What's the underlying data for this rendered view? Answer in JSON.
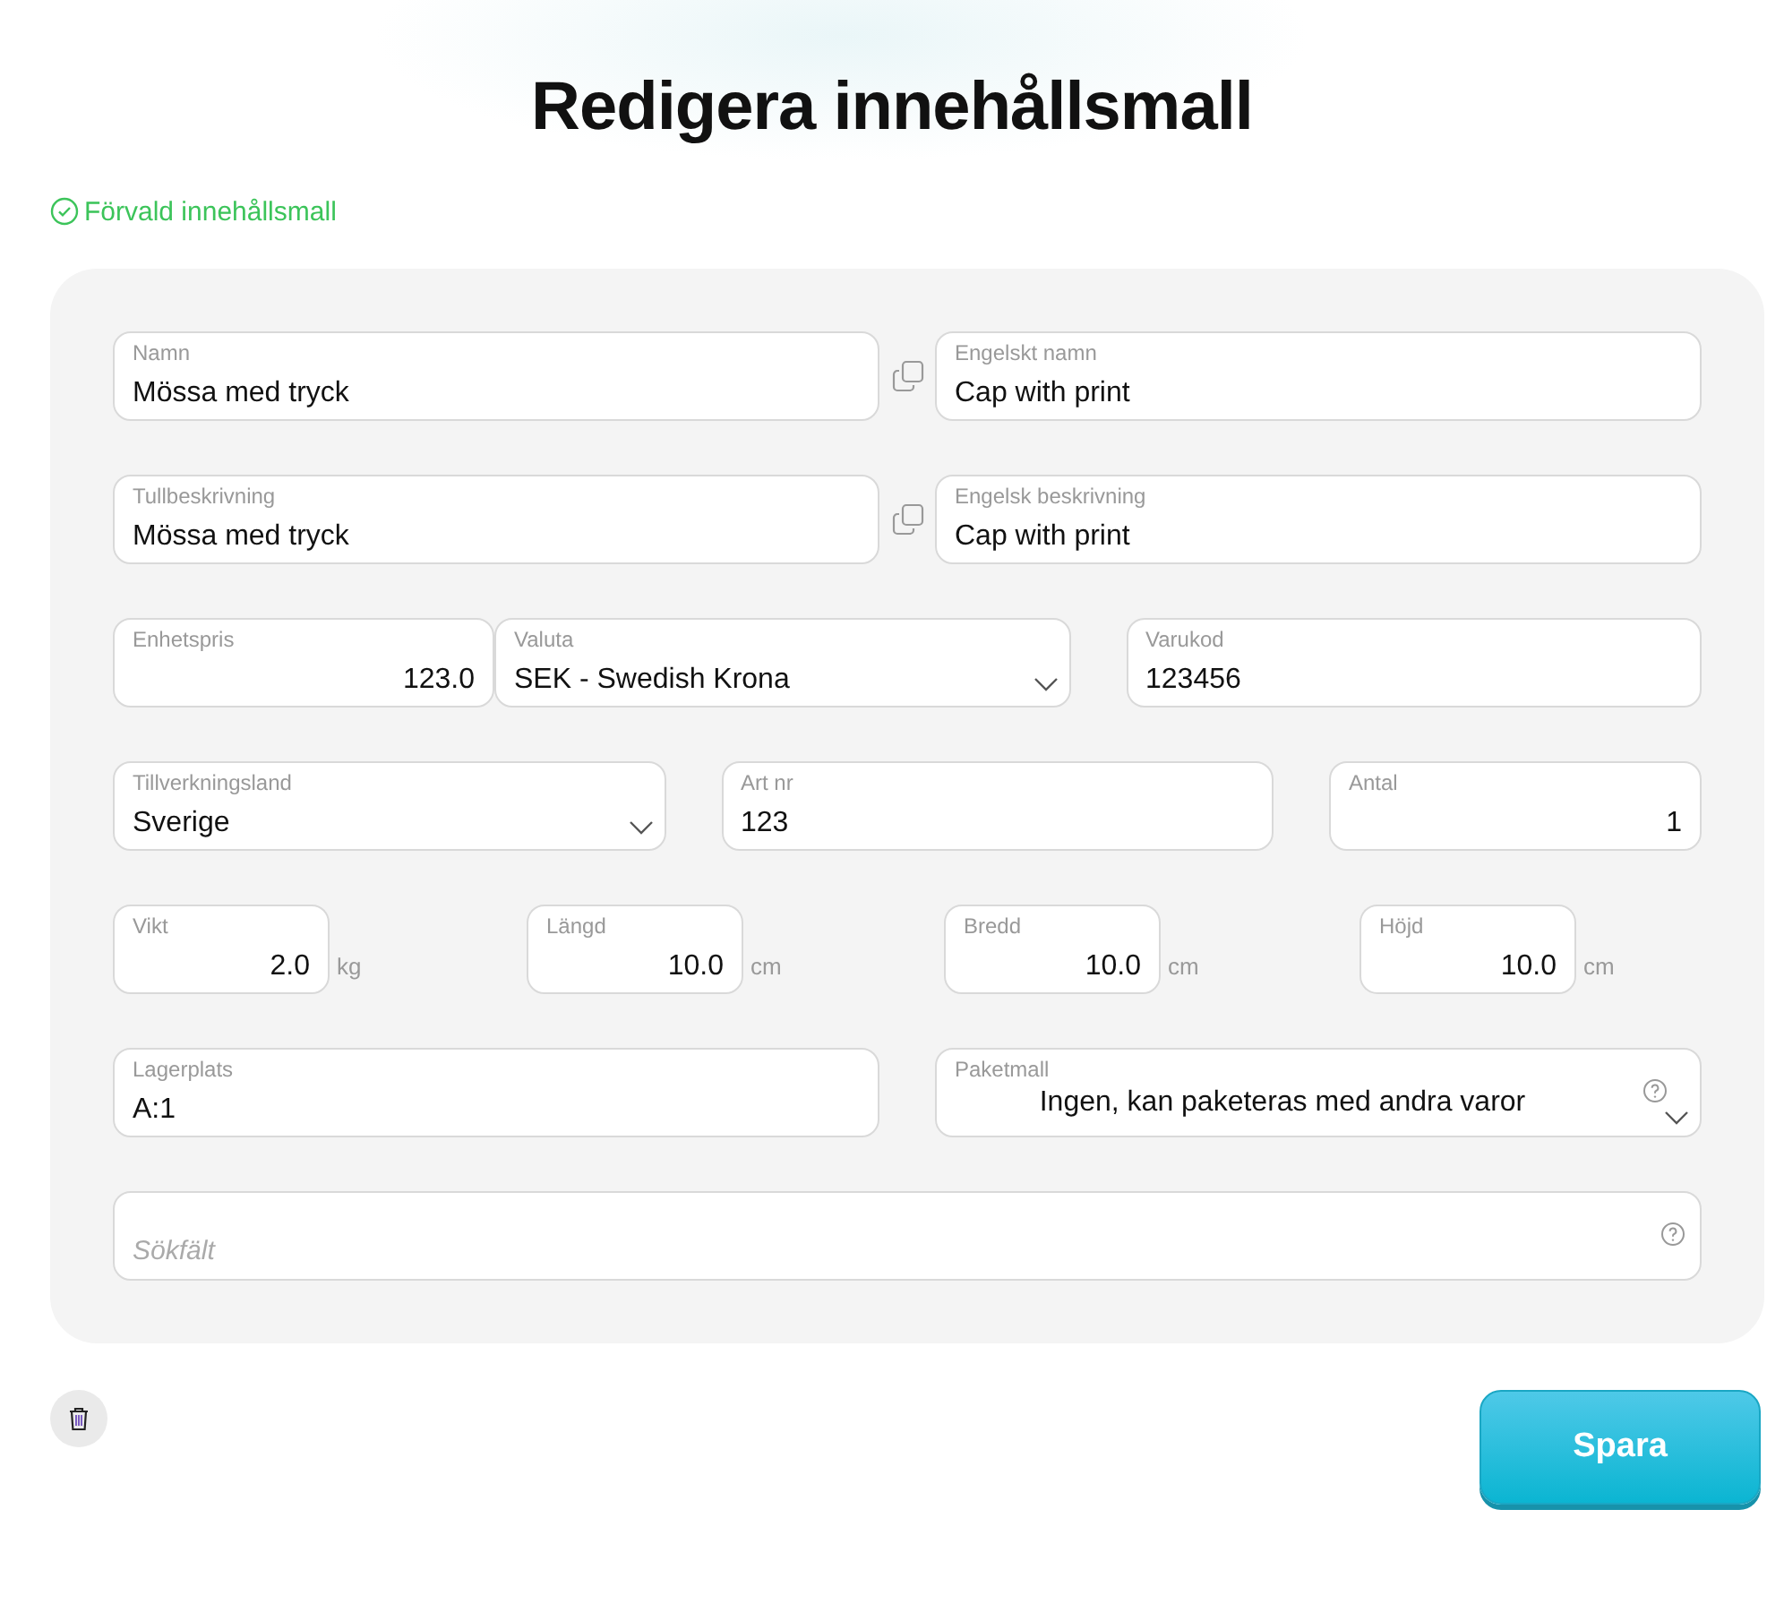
{
  "title": "Redigera innehållsmall",
  "default_badge": {
    "label": "Förvald innehållsmall",
    "checked": true
  },
  "rows": [
    {
      "kind": "pair",
      "fields": [
        {
          "kind": "text",
          "label": "Namn",
          "value": "Mössa med tryck",
          "copy": true
        },
        {
          "kind": "text",
          "label": "Engelskt namn",
          "value": "Cap with print"
        }
      ]
    },
    {
      "kind": "pair",
      "fields": [
        {
          "kind": "text",
          "label": "Tullbeskrivning",
          "value": "Mössa med tryck",
          "copy": true
        },
        {
          "kind": "text",
          "label": "Engelsk beskrivning",
          "value": "Cap with print"
        }
      ]
    },
    {
      "kind": "price",
      "fields": [
        {
          "kind": "number",
          "label": "Enhetspris",
          "value": "123.0"
        },
        {
          "kind": "select",
          "label": "Valuta",
          "value": "SEK - Swedish Krona"
        },
        {
          "kind": "text",
          "label": "Varukod",
          "value": "123456"
        }
      ]
    },
    {
      "kind": "triple",
      "fields": [
        {
          "kind": "select",
          "label": "Tillverkningsland",
          "value": "Sverige"
        },
        {
          "kind": "text",
          "label": "Art nr",
          "value": "123"
        },
        {
          "kind": "number",
          "label": "Antal",
          "value": "1"
        }
      ]
    },
    {
      "kind": "dimensions",
      "fields": [
        {
          "kind": "number",
          "label": "Vikt",
          "value": "2.0",
          "unit": "kg"
        },
        {
          "kind": "number",
          "label": "Längd",
          "value": "10.0",
          "unit": "cm"
        },
        {
          "kind": "number",
          "label": "Bredd",
          "value": "10.0",
          "unit": "cm"
        },
        {
          "kind": "number",
          "label": "Höjd",
          "value": "10.0",
          "unit": "cm"
        }
      ]
    },
    {
      "kind": "pair",
      "fields": [
        {
          "kind": "text",
          "label": "Lagerplats",
          "value": "A:1"
        },
        {
          "kind": "template",
          "label": "Paketmall",
          "value": "Ingen, kan paketeras med andra varor",
          "help": true
        }
      ]
    },
    {
      "kind": "full",
      "fields": [
        {
          "kind": "search",
          "placeholder": "Sökfält",
          "help": true
        }
      ]
    }
  ],
  "save_button": "Spara"
}
